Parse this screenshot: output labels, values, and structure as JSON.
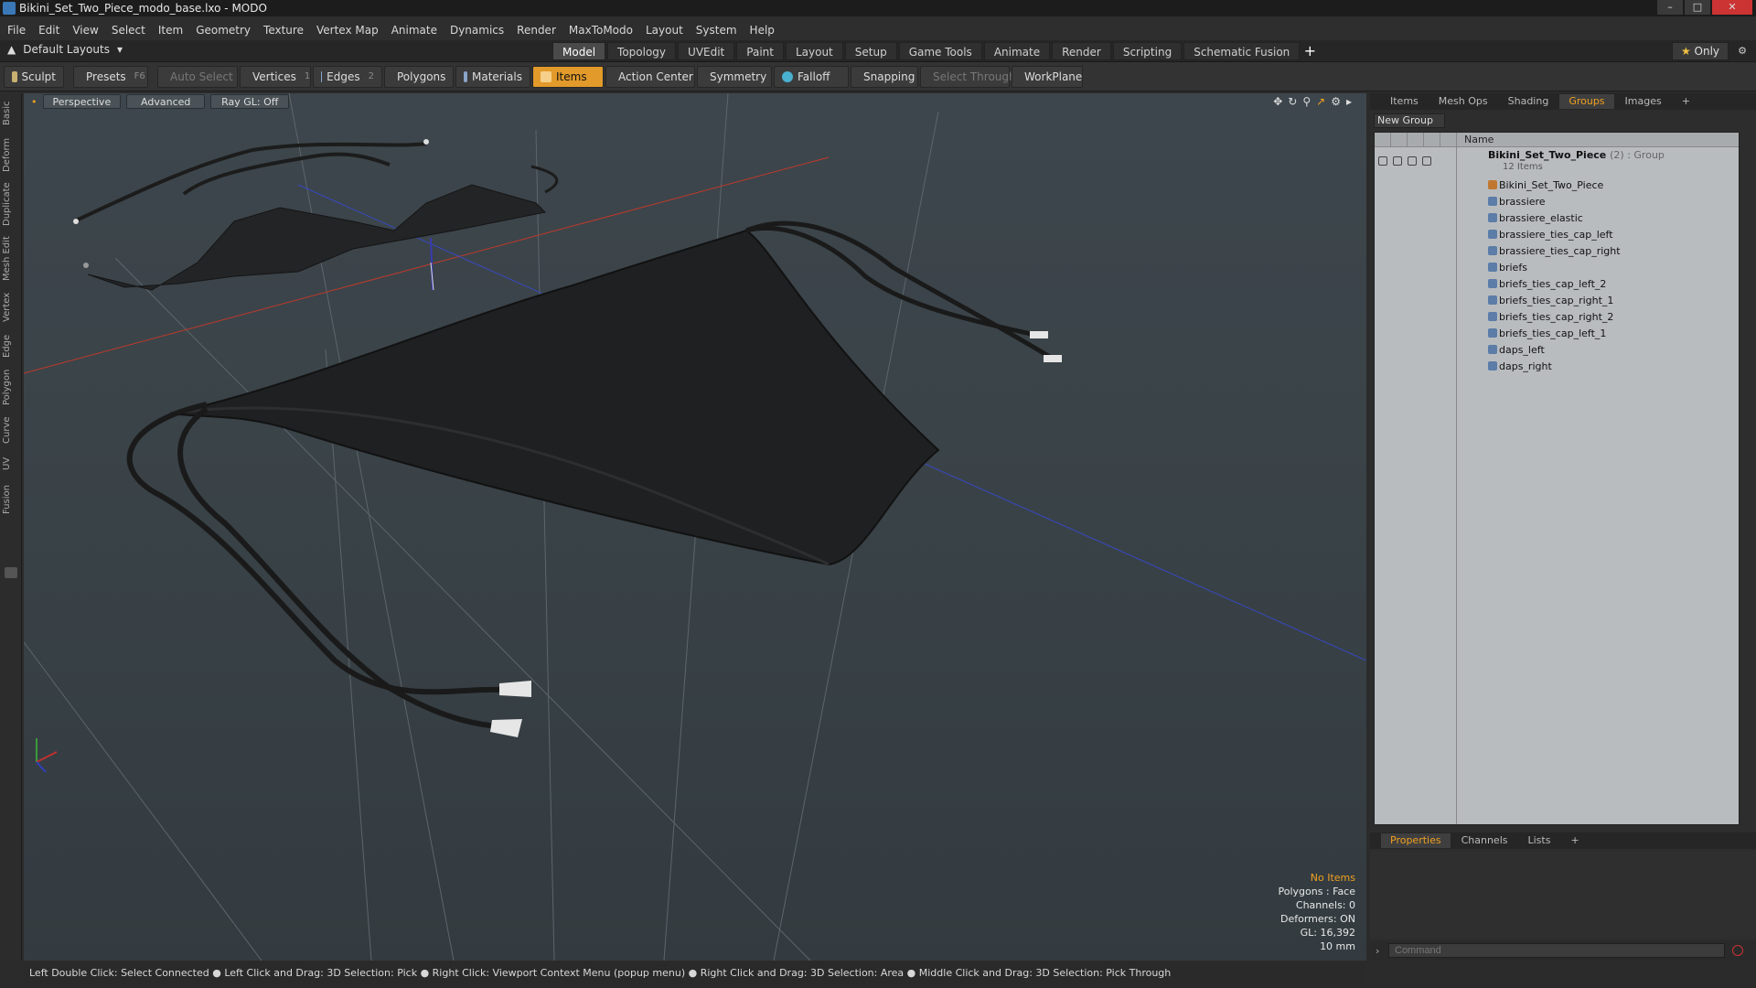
{
  "window": {
    "title": "Bikini_Set_Two_Piece_modo_base.lxo - MODO"
  },
  "menu": [
    "File",
    "Edit",
    "View",
    "Select",
    "Item",
    "Geometry",
    "Texture",
    "Vertex Map",
    "Animate",
    "Dynamics",
    "Render",
    "MaxToModo",
    "Layout",
    "System",
    "Help"
  ],
  "layout": {
    "default_layouts": "Default Layouts",
    "tabs": [
      "Model",
      "Topology",
      "UVEdit",
      "Paint",
      "Layout",
      "Setup",
      "Game Tools",
      "Animate",
      "Render",
      "Scripting",
      "Schematic Fusion"
    ],
    "active_tab": "Model",
    "only_label": "Only"
  },
  "toolbar": {
    "sculpt": "Sculpt",
    "presets": "Presets",
    "presets_key": "F6",
    "auto_select": "Auto Select",
    "vertices": "Vertices",
    "vertices_count": "1",
    "edges": "Edges",
    "edges_count": "2",
    "polygons": "Polygons",
    "materials": "Materials",
    "items": "Items",
    "action_center": "Action Center",
    "symmetry": "Symmetry",
    "falloff": "Falloff",
    "snapping": "Snapping",
    "select_through": "Select Through",
    "workplane": "WorkPlane"
  },
  "left_tabs": [
    "Basic",
    "Deform",
    "Duplicate",
    "Mesh Edit",
    "Vertex",
    "Edge",
    "Polygon",
    "Curve",
    "UV",
    "Fusion"
  ],
  "viewport": {
    "perspective": "Perspective",
    "advanced": "Advanced",
    "raygl": "Ray GL: Off",
    "info": {
      "no_items": "No Items",
      "polygons": "Polygons : Face",
      "channels": "Channels: 0",
      "deformers": "Deformers: ON",
      "gl": "GL: 16,392",
      "scale": "10 mm"
    }
  },
  "status": "Left Double Click: Select Connected ● Left Click and Drag: 3D Selection: Pick ● Right Click: Viewport Context Menu (popup menu) ● Right Click and Drag: 3D Selection: Area ● Middle Click and Drag: 3D Selection: Pick Through",
  "right_panel": {
    "tabs": [
      "Items",
      "Mesh Ops",
      "Shading",
      "Groups",
      "Images"
    ],
    "active_tab": "Groups",
    "new_group": "New Group",
    "column_name": "Name",
    "group": {
      "name": "Bikini_Set_Two_Piece",
      "suffix": "(2) : Group",
      "count": "12 Items"
    },
    "items": [
      "Bikini_Set_Two_Piece",
      "brassiere",
      "brassiere_elastic",
      "brassiere_ties_cap_left",
      "brassiere_ties_cap_right",
      "briefs",
      "briefs_ties_cap_left_2",
      "briefs_ties_cap_right_1",
      "briefs_ties_cap_right_2",
      "briefs_ties_cap_left_1",
      "daps_left",
      "daps_right"
    ],
    "bottom_tabs": [
      "Properties",
      "Channels",
      "Lists"
    ],
    "bottom_active": "Properties",
    "command_placeholder": "Command"
  },
  "colors": {
    "accent": "#f0a020",
    "active_tool": "#e29a2a"
  }
}
